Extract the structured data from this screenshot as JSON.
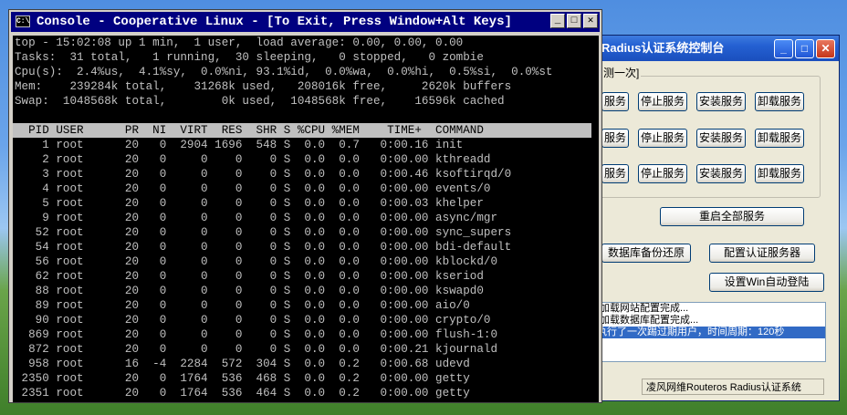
{
  "bg_window": {
    "title": "Radius认证系统控制台",
    "group_label": "测一次]",
    "rows": [
      [
        "服务",
        "停止服务",
        "安装服务",
        "卸载服务"
      ],
      [
        "服务",
        "停止服务",
        "安装服务",
        "卸载服务"
      ],
      [
        "服务",
        "停止服务",
        "安装服务",
        "卸载服务"
      ]
    ],
    "restart_all": "重启全部服务",
    "db_backup": "数据库备份还原",
    "config_auth": "配置认证服务器",
    "auto_login": "设置Win自动登陆",
    "log": [
      "/加载网站配置完成...",
      "/加载数据库配置完成...",
      "执行了一次踢过期用户，时间周期：120秒"
    ],
    "status": "凌风网维Routeros Radius认证系统"
  },
  "console": {
    "title": "Console - Cooperative Linux - [To Exit, Press Window+Alt Keys]",
    "summary": [
      "top - 15:02:08 up 1 min,  1 user,  load average: 0.00, 0.00, 0.00",
      "Tasks:  31 total,   1 running,  30 sleeping,   0 stopped,   0 zombie",
      "Cpu(s):  2.4%us,  4.1%sy,  0.0%ni, 93.1%id,  0.0%wa,  0.0%hi,  0.5%si,  0.0%st",
      "Mem:    239284k total,    31268k used,   208016k free,     2620k buffers",
      "Swap:  1048568k total,        0k used,  1048568k free,    16596k cached",
      ""
    ],
    "header": "  PID USER      PR  NI  VIRT  RES  SHR S %CPU %MEM    TIME+  COMMAND         ",
    "processes": [
      "    1 root      20   0  2904 1696  548 S  0.0  0.7   0:00.16 init",
      "    2 root      20   0     0    0    0 S  0.0  0.0   0:00.00 kthreadd",
      "    3 root      20   0     0    0    0 S  0.0  0.0   0:00.46 ksoftirqd/0",
      "    4 root      20   0     0    0    0 S  0.0  0.0   0:00.00 events/0",
      "    5 root      20   0     0    0    0 S  0.0  0.0   0:00.03 khelper",
      "    9 root      20   0     0    0    0 S  0.0  0.0   0:00.00 async/mgr",
      "   52 root      20   0     0    0    0 S  0.0  0.0   0:00.00 sync_supers",
      "   54 root      20   0     0    0    0 S  0.0  0.0   0:00.00 bdi-default",
      "   56 root      20   0     0    0    0 S  0.0  0.0   0:00.00 kblockd/0",
      "   62 root      20   0     0    0    0 S  0.0  0.0   0:00.00 kseriod",
      "   88 root      20   0     0    0    0 S  0.0  0.0   0:00.00 kswapd0",
      "   89 root      20   0     0    0    0 S  0.0  0.0   0:00.00 aio/0",
      "   90 root      20   0     0    0    0 S  0.0  0.0   0:00.00 crypto/0",
      "  869 root      20   0     0    0    0 S  0.0  0.0   0:00.00 flush-1:0",
      "  872 root      20   0     0    0    0 S  0.0  0.0   0:00.21 kjournald",
      "  958 root      16  -4  2284  572  304 S  0.0  0.2   0:00.68 udevd",
      " 2350 root      20   0  1764  536  468 S  0.0  0.2   0:00.00 getty",
      " 2351 root      20   0  1764  536  464 S  0.0  0.2   0:00.00 getty"
    ]
  }
}
